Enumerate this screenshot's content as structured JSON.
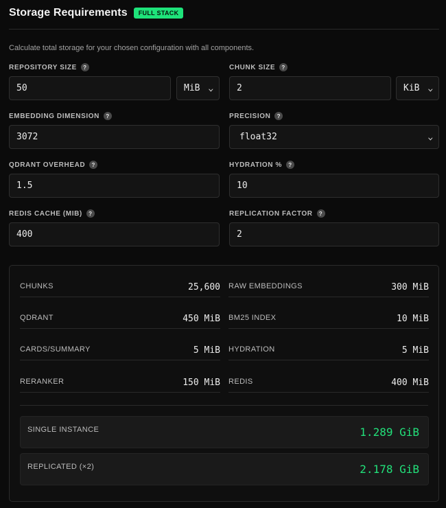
{
  "header": {
    "title": "Storage Requirements",
    "badge": "FULL STACK",
    "description": "Calculate total storage for your chosen configuration with all components."
  },
  "help_glyph": "?",
  "chevron_glyph": "⌄",
  "fields": {
    "repository_size": {
      "label": "REPOSITORY SIZE",
      "value": "50",
      "unit": "MiB"
    },
    "chunk_size": {
      "label": "CHUNK SIZE",
      "value": "2",
      "unit": "KiB"
    },
    "embedding_dimension": {
      "label": "EMBEDDING DIMENSION",
      "value": "3072"
    },
    "precision": {
      "label": "PRECISION",
      "value": "float32"
    },
    "qdrant_overhead": {
      "label": "QDRANT OVERHEAD",
      "value": "1.5"
    },
    "hydration": {
      "label": "HYDRATION %",
      "value": "10"
    },
    "redis_cache": {
      "label": "REDIS CACHE (MIB)",
      "value": "400"
    },
    "replication_factor": {
      "label": "REPLICATION FACTOR",
      "value": "2"
    }
  },
  "metrics": [
    {
      "label": "CHUNKS",
      "value": "25,600"
    },
    {
      "label": "RAW EMBEDDINGS",
      "value": "300 MiB"
    },
    {
      "label": "QDRANT",
      "value": "450 MiB"
    },
    {
      "label": "BM25 INDEX",
      "value": "10 MiB"
    },
    {
      "label": "CARDS/SUMMARY",
      "value": "5 MiB"
    },
    {
      "label": "HYDRATION",
      "value": "5 MiB"
    },
    {
      "label": "RERANKER",
      "value": "150 MiB"
    },
    {
      "label": "REDIS",
      "value": "400 MiB"
    }
  ],
  "totals": {
    "single": {
      "label": "SINGLE INSTANCE",
      "value": "1.289 GiB"
    },
    "replicated": {
      "label": "REPLICATED (×2)",
      "value": "2.178 GiB"
    }
  },
  "colors": {
    "accent": "#22e07a",
    "badge_bg": "#1ee37a",
    "background": "#0b0b0b"
  }
}
